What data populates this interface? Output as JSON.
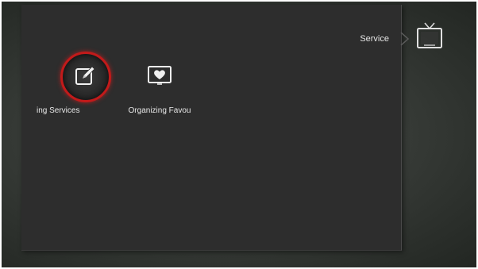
{
  "menu": {
    "items": [
      {
        "label": "ing Services",
        "icon": "edit-pencil-icon",
        "selected": true
      },
      {
        "label": "Organizing Favou",
        "icon": "favourite-heart-tv-icon",
        "selected": false
      }
    ]
  },
  "breadcrumb": {
    "current": "Service",
    "icon": "tv-icon"
  },
  "colors": {
    "panel": "#2d2d2d",
    "selection_ring": "#c21a1a",
    "text": "#e8e8e8"
  }
}
